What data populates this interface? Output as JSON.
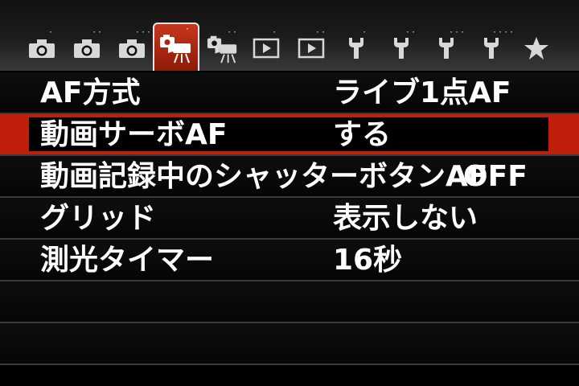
{
  "tabs": [
    {
      "name": "shooting-1",
      "icon": "camera-icon",
      "dots": "·"
    },
    {
      "name": "shooting-2",
      "icon": "camera-icon",
      "dots": "··"
    },
    {
      "name": "shooting-3",
      "icon": "camera-icon",
      "dots": "···"
    },
    {
      "name": "movie-1",
      "icon": "movie-camera-icon",
      "dots": "·",
      "active": true
    },
    {
      "name": "movie-2",
      "icon": "movie-camera-icon",
      "dots": "··"
    },
    {
      "name": "playback-1",
      "icon": "play-icon",
      "dots": "·"
    },
    {
      "name": "playback-2",
      "icon": "play-icon",
      "dots": "··"
    },
    {
      "name": "setup-1",
      "icon": "wrench-icon",
      "dots": "·"
    },
    {
      "name": "setup-2",
      "icon": "wrench-icon",
      "dots": "··"
    },
    {
      "name": "setup-3",
      "icon": "wrench-icon",
      "dots": "···"
    },
    {
      "name": "setup-4",
      "icon": "wrench-icon",
      "dots": "····"
    },
    {
      "name": "my-menu",
      "icon": "star-icon",
      "dots": ""
    }
  ],
  "menu": {
    "items": [
      {
        "label": "AF方式",
        "value": "ライブ1点AF"
      },
      {
        "label": "動画サーボAF",
        "value": "する"
      },
      {
        "label": "動画記録中のシャッターボタンAF",
        "value": "OFF"
      },
      {
        "label": "グリッド",
        "value": "表示しない"
      },
      {
        "label": "測光タイマー",
        "value": "16秒"
      }
    ]
  },
  "colors": {
    "accent": "#c01d0b",
    "background": "#000000",
    "tab_icon": "#d8d8d8"
  }
}
